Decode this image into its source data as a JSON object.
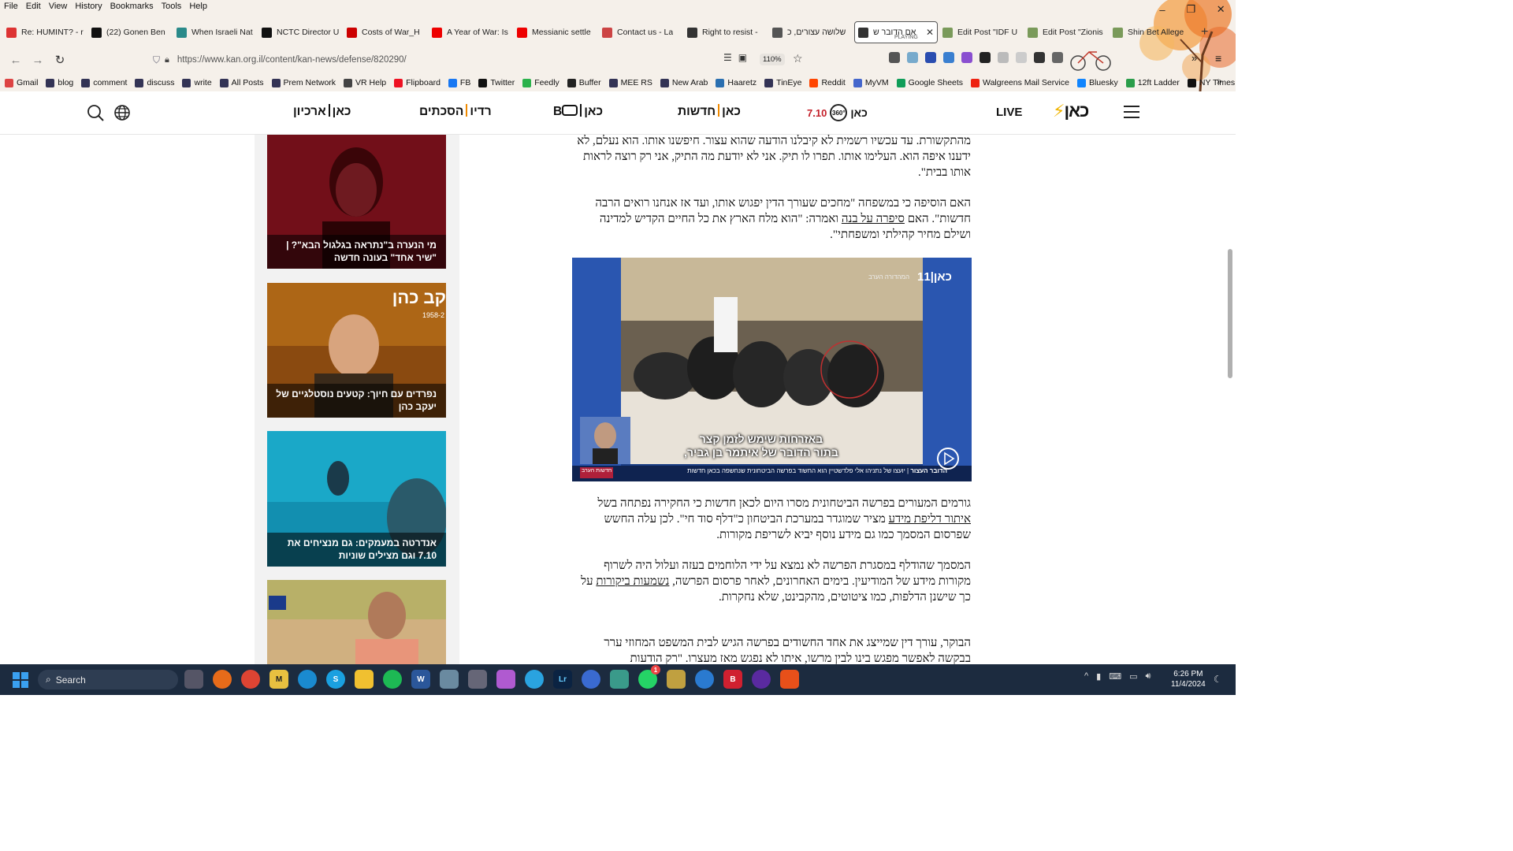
{
  "menu": [
    "File",
    "Edit",
    "View",
    "History",
    "Bookmarks",
    "Tools",
    "Help"
  ],
  "tabs": [
    {
      "label": "Re: HUMINT? - r",
      "color": "#d33"
    },
    {
      "label": "(22) Gonen Ben",
      "color": "#111"
    },
    {
      "label": "When Israeli Nat",
      "color": "#2a8a8a"
    },
    {
      "label": "NCTC Director U",
      "color": "#111"
    },
    {
      "label": "Costs of War_H",
      "color": "#c00"
    },
    {
      "label": "A Year of War: Is",
      "color": "#e00"
    },
    {
      "label": "Messianic settle",
      "color": "#e00"
    },
    {
      "label": "Contact us - La",
      "color": "#c44"
    },
    {
      "label": "Right to resist -",
      "color": "#333"
    },
    {
      "label": "שלושה עצורים, כ",
      "color": "#555"
    },
    {
      "label": "אם הדובר ש",
      "color": "#333",
      "active": true,
      "sub": "PLAYING"
    },
    {
      "label": "Edit Post \"IDF U",
      "color": "#7a9a5a"
    },
    {
      "label": "Edit Post \"Zionis",
      "color": "#7a9a5a"
    },
    {
      "label": "Shin Bet Allege",
      "color": "#7a9a5a"
    }
  ],
  "url": "https://www.kan.org.il/content/kan-news/defense/820290/",
  "zoom": "110%",
  "bookmarks": [
    {
      "label": "Gmail",
      "color": "#d44"
    },
    {
      "label": "blog",
      "color": "#335"
    },
    {
      "label": "comment",
      "color": "#335"
    },
    {
      "label": "discuss",
      "color": "#335"
    },
    {
      "label": "write",
      "color": "#335"
    },
    {
      "label": "All Posts",
      "color": "#335"
    },
    {
      "label": "Prem Network",
      "color": "#335"
    },
    {
      "label": "VR Help",
      "color": "#444"
    },
    {
      "label": "Flipboard",
      "color": "#e12"
    },
    {
      "label": "FB",
      "color": "#1877f2"
    },
    {
      "label": "Twitter",
      "color": "#111"
    },
    {
      "label": "Feedly",
      "color": "#2bb24c"
    },
    {
      "label": "Buffer",
      "color": "#222"
    },
    {
      "label": "MEE RS",
      "color": "#335"
    },
    {
      "label": "New Arab",
      "color": "#335"
    },
    {
      "label": "Haaretz",
      "color": "#2a6fb0"
    },
    {
      "label": "TinEye",
      "color": "#335"
    },
    {
      "label": "Reddit",
      "color": "#ff4500"
    },
    {
      "label": "MyVM",
      "color": "#4466cc"
    },
    {
      "label": "Google Sheets",
      "color": "#0f9d58"
    },
    {
      "label": "Walgreens Mail Service",
      "color": "#e21"
    },
    {
      "label": "Bluesky",
      "color": "#1185fe"
    },
    {
      "label": "12ft Ladder",
      "color": "#2a9d4a"
    },
    {
      "label": "NY Times",
      "color": "#111"
    }
  ],
  "site_nav": {
    "live": "LIVE",
    "kan_logo": "כאן",
    "badge_710": "7.10",
    "badge_360": "360°",
    "news": "חדשות",
    "box_kan": "כאן",
    "box": "B",
    "podcasts": "הסכתים",
    "radio": "רדיו",
    "archive_kan": "כאן",
    "archive": "ארכיון"
  },
  "sidebar_cards": [
    {
      "caption": "מי הנערה ב\"נתראה בגלגול הבא\"? | \"שיר אחד\" בעונה חדשה"
    },
    {
      "caption": "נפרדים עם חיוך: קטעים נוסטלגיים של יעקב כהן",
      "overlay_text": "קב כהן",
      "overlay_years": "1958-2"
    },
    {
      "caption": "אנדרטה במעמקים: גם מנציחים את 7.10 וגם מצילים שוניות"
    },
    {
      "caption": ""
    }
  ],
  "article": {
    "p1": "מהתקשורת. עד עכשיו רשמית לא קיבלנו הודעה שהוא עצור. חיפשנו אותו. הוא נעלם, לא ידענו איפה הוא. העלימו אותו. תפרו לו תיק. אני לא יודעת מה התיק, אני רק רוצה לראות אותו בבית\".",
    "p2_a": "האם הוסיפה כי במשפחה \"מחכים שעורך הדין יפגוש אותו, ועד אז אנחנו רואים הרבה חדשות\". האם ",
    "p2_link": "סיפרה על בנה",
    "p2_b": " ואמרה: \"הוא מלח הארץ את כל החיים הקדיש למדינה ושילם מחיר קהילתי ומשפחתי\".",
    "p3_a": "גורמים המעורים בפרשה הביטחונית מסרו היום לכאן חדשות כי החקירה נפתחה בשל ",
    "p3_link": "איתור דליפת מידע",
    "p3_b": " מציר שמוגדר במערכת הביטחון כ\"דלף סוד חי\". לכן עלה החשש שפרסום המסמך כמו גם מידע נוסף יביא לשריפת מקורות.",
    "p4_a": "המסמך שהודלף במסגרת הפרשה לא נמצא על ידי הלוחמים בעזה ועלול היה לשרוף מקורות מידע של המודיעין. בימים האחרונים, לאחר פרסום הפרשה, ",
    "p4_link": "נשמעות ביקורות",
    "p4_b": " על כך שישנן הדלפות, כמו ציטוטים, מהקבינט, שלא נחקרות.",
    "p5": "הבוקר, עורך דין שמייצג את אחד החשודים בפרשה הגיש לבית המשפט המחוזי ערר בבקשה לאפשר מפגש בינו לבין מרשו, איתו לא נפגש מאז מעצרו. \"רק הודעות"
  },
  "video": {
    "logo": "כאן|11",
    "subtitle_line1": "באזרחות שימש לזמן קצר",
    "subtitle_line2": "בתור הדובר של איתמר בן גביר,",
    "ticker_label": "הדובר העצור",
    "ticker_text": "יועצו של נתניהו אלי פלדשטיין הוא החשוד בפרשה הביטחונית שנחשפה בכאן חדשות",
    "ticker_tag": "חדשות הערב",
    "top_tag_1": "המהדורה",
    "top_tag_2": "הערב"
  },
  "taskbar": {
    "search_placeholder": "Search",
    "time": "6:26 PM",
    "date": "11/4/2024",
    "whatsapp_badge": "1"
  },
  "colors": {
    "chrome_bg": "#f5f0ea",
    "taskbar_bg": "#1c2b3f",
    "kan_orange": "#f08a00",
    "badge_red": "#c4202a"
  }
}
